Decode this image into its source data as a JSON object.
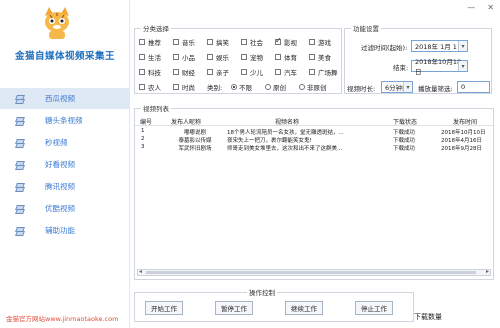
{
  "app": {
    "title": "金猫自媒体视频采集王",
    "footer": "金猫官方网站www.jinmaotaoke.com"
  },
  "window_controls": {
    "minimize": "—",
    "close": "✕"
  },
  "nav": [
    {
      "label": "西瓜视频",
      "active": true
    },
    {
      "label": "糖头条视频",
      "active": false
    },
    {
      "label": "秒视频",
      "active": false
    },
    {
      "label": "好看视频",
      "active": false
    },
    {
      "label": "腾讯视频",
      "active": false
    },
    {
      "label": "优酷视频",
      "active": false
    },
    {
      "label": "辅助功能",
      "active": false
    }
  ],
  "categories": {
    "title": "分类选择",
    "rows": [
      [
        {
          "label": "推荐",
          "checked": false
        },
        {
          "label": "音乐",
          "checked": false
        },
        {
          "label": "搞笑",
          "checked": false
        },
        {
          "label": "社会",
          "checked": false
        },
        {
          "label": "影视",
          "checked": true
        },
        {
          "label": "游戏",
          "checked": false
        }
      ],
      [
        {
          "label": "生活",
          "checked": false
        },
        {
          "label": "小品",
          "checked": false
        },
        {
          "label": "娱乐",
          "checked": false
        },
        {
          "label": "宠物",
          "checked": false
        },
        {
          "label": "体育",
          "checked": false
        },
        {
          "label": "美食",
          "checked": false
        }
      ],
      [
        {
          "label": "科技",
          "checked": false
        },
        {
          "label": "财经",
          "checked": false
        },
        {
          "label": "亲子",
          "checked": false
        },
        {
          "label": "少儿",
          "checked": false
        },
        {
          "label": "汽车",
          "checked": false
        },
        {
          "label": "广场舞",
          "checked": false
        }
      ]
    ],
    "extra": {
      "label": "农人",
      "checked": false
    },
    "extra2": {
      "label": "时尚",
      "checked": false
    },
    "type_label": "类别:",
    "type_options": [
      {
        "label": "不限",
        "checked": true
      },
      {
        "label": "原创",
        "checked": false
      },
      {
        "label": "非原创",
        "checked": false
      }
    ]
  },
  "func": {
    "title": "功能设置",
    "start_label": "过滤时间(起始):",
    "start_value": "2018年 1月 1日",
    "end_label": "结束:",
    "end_value": "2018年10月18日",
    "duration_label": "视频时长:",
    "duration_value": "6分钟内",
    "plays_label": "播放量筛选:",
    "plays_value": "0"
  },
  "list": {
    "title": "视频列表",
    "headers": [
      "编号",
      "发布人昵称",
      "视频名称",
      "下载状态",
      "发布时间"
    ],
    "rows": [
      [
        "1",
        "嘟嘟说剧",
        "18个男人轮流陪员一名女孩，堂无雕透斑结，...",
        "下载成功",
        "2018年10月10日"
      ],
      [
        "2",
        "泰墓影以传媒",
        "夜宋失上一把刀，裹尔翻能笑女鬼!",
        "下载成功",
        "2018年4月16日"
      ],
      [
        "3",
        "军武怀旧剧场",
        "师哥走到美女堆里去，这次和出不来了这群美...",
        "下载成功",
        "2018年9月28日"
      ]
    ]
  },
  "ops": {
    "title": "操作控制",
    "buttons": [
      "开始工作",
      "暂停工作",
      "继续工作",
      "停止工作"
    ],
    "download_label": "下载数量"
  }
}
